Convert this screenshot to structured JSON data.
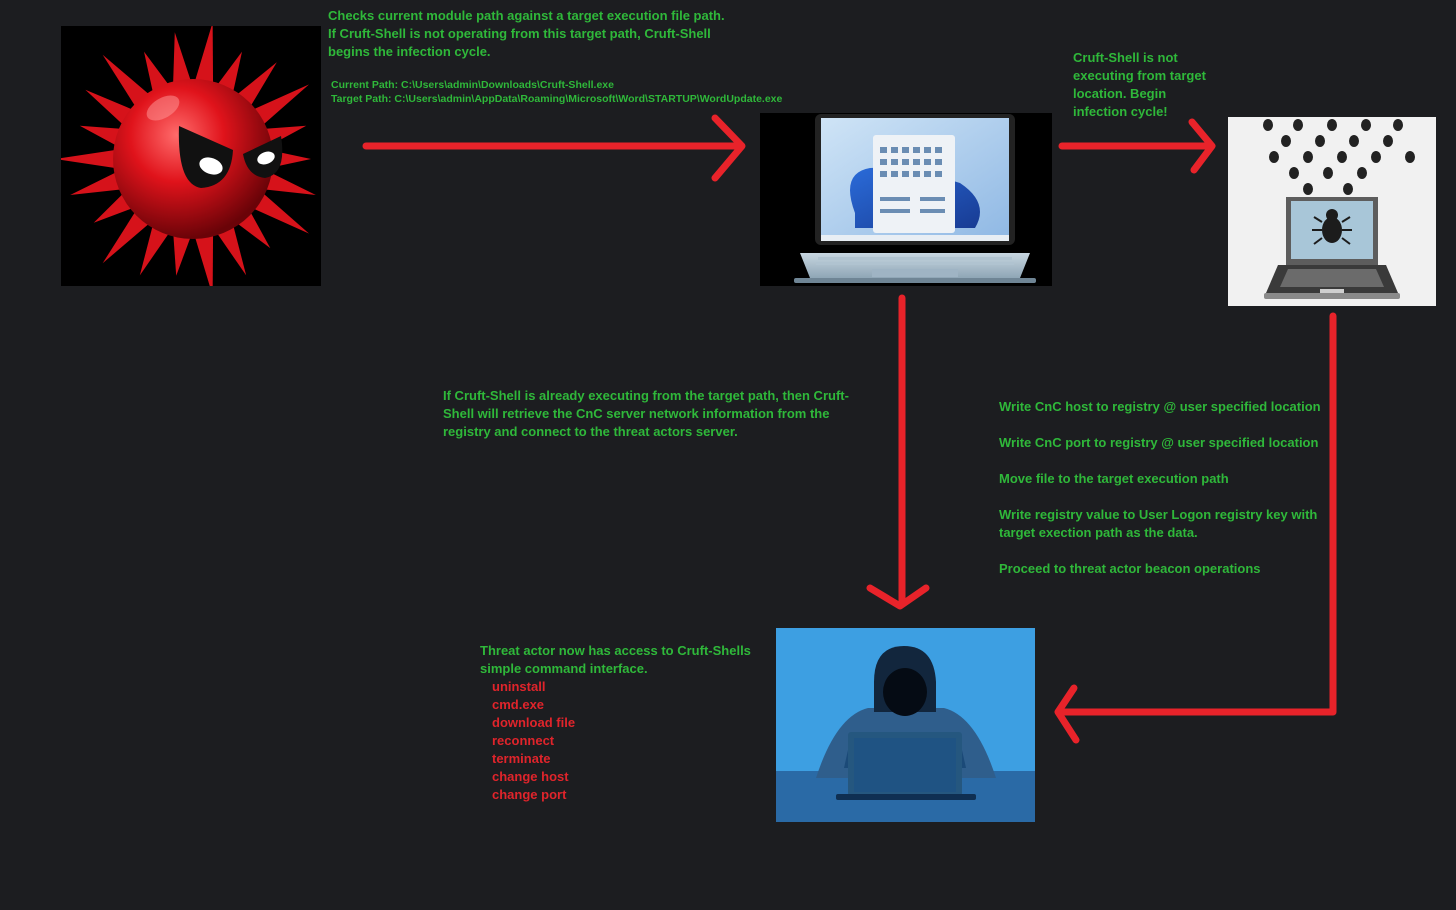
{
  "intro": {
    "lines": [
      "Checks current module path against a target execution file path.",
      "If Cruft-Shell is not operating from this target path,  Cruft-Shell",
      "begins the infection cycle."
    ],
    "current_path": "Current Path: C:\\Users\\admin\\Downloads\\Cruft-Shell.exe",
    "target_path": "Target Path: C:\\Users\\admin\\AppData\\Roaming\\Microsoft\\Word\\STARTUP\\WordUpdate.exe"
  },
  "not_target": {
    "lines": [
      "Cruft-Shell is not",
      "executing from target",
      "location. Begin",
      "infection cycle!"
    ]
  },
  "already_target": {
    "lines": [
      "If Cruft-Shell is already executing from the target path, then Cruft-",
      "Shell will retrieve the CnC server network information from the",
      "registry and connect to the threat actors server."
    ]
  },
  "steps": [
    "Write CnC host to registry @ user specified location",
    "Write CnC port to registry @ user specified location",
    "Move file to the target execution path",
    "Write registry value to User Logon registry key with",
    "target exection path as the data.",
    "Proceed to threat actor beacon operations"
  ],
  "access": {
    "lines": [
      "Threat actor now has access to Cruft-Shells",
      "simple command interface."
    ],
    "commands": [
      "uninstall",
      "cmd.exe",
      "download file",
      "reconnect",
      "terminate",
      "change host",
      "change port"
    ]
  },
  "colors": {
    "background": "#1c1d20",
    "text_green": "#2fb83a",
    "text_red": "#e0242b",
    "arrow_red": "#e8232a"
  }
}
